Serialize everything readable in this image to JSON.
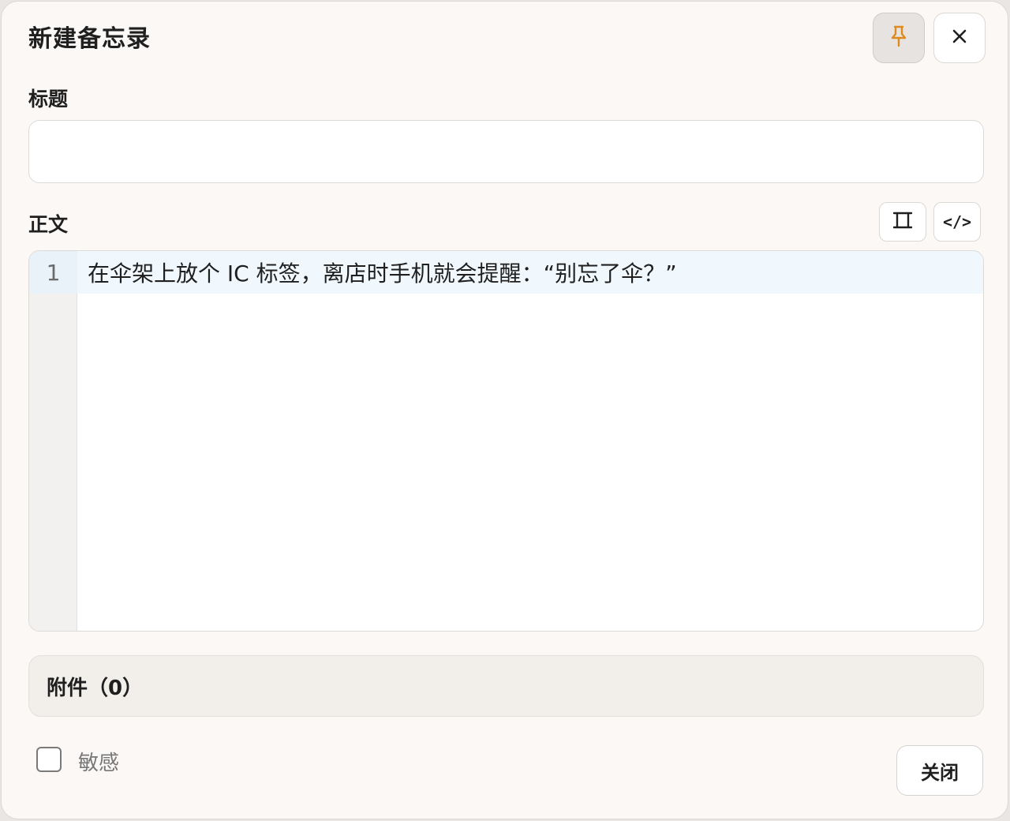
{
  "dialog": {
    "title": "新建备忘录",
    "pin_icon": "pin-icon",
    "close_icon": "close-icon"
  },
  "title_field": {
    "label": "标题",
    "value": "",
    "placeholder": ""
  },
  "body_field": {
    "label": "正文",
    "fullscreen_icon": "fullscreen-icon",
    "code_toggle_label": "</>",
    "lines": [
      {
        "number": "1",
        "text": "在伞架上放个 IC 标签，离店时手机就会提醒：“别忘了伞？”"
      }
    ]
  },
  "attachments": {
    "label": "附件（0）"
  },
  "sensitive": {
    "label": "敏感",
    "checked": false
  },
  "footer": {
    "close_label": "关闭"
  },
  "colors": {
    "accent_pin": "#e08a1e",
    "active_line": "#f0f8fd",
    "dialog_bg": "#fbf8f6"
  }
}
